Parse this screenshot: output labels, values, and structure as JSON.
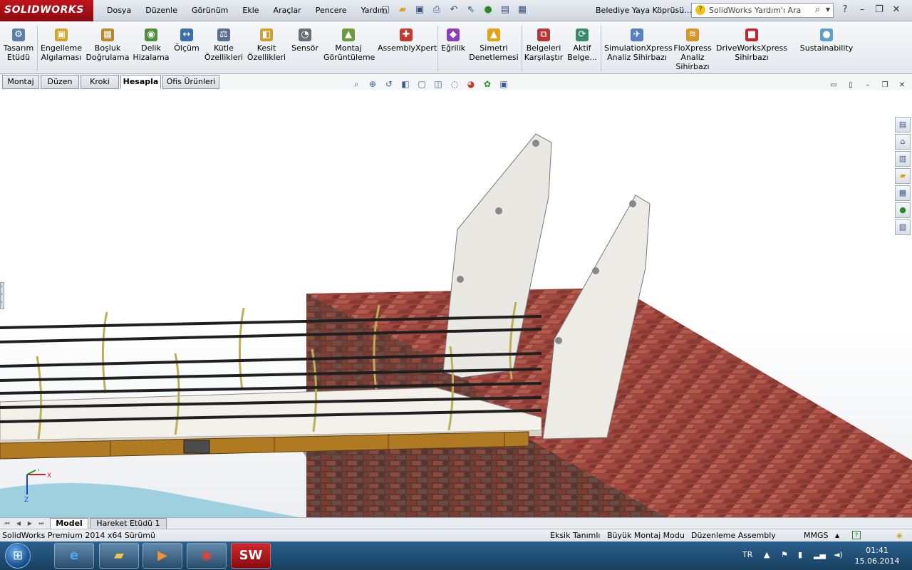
{
  "app": {
    "logo": "SOLIDWORKS",
    "doc_title": "Belediye Yaya Köprüsü...."
  },
  "menu": [
    "Dosya",
    "Düzenle",
    "Görünüm",
    "Ekle",
    "Araçlar",
    "Pencere",
    "Yardım"
  ],
  "quick_access": {
    "pin": "pin-icon",
    "new": "new-document-icon",
    "open": "open-folder-icon",
    "save": "save-icon",
    "print": "print-icon",
    "undo": "undo-icon",
    "select": "select-arrow-icon",
    "rebuild": "rebuild-traffic-light-icon",
    "file_props": "file-properties-icon",
    "options": "options-icon"
  },
  "search": {
    "placeholder": "SolidWorks Yardım'ı Ara"
  },
  "ribbon": [
    {
      "l1": "Tasarım",
      "l2": "Etüdü",
      "icon": "design-study-icon",
      "color": "#5b7fa6"
    },
    {
      "l1": "Engelleme",
      "l2": "Algılaması",
      "icon": "interference-detection-icon",
      "color": "#d0a52a"
    },
    {
      "l1": "Boşluk",
      "l2": "Doğrulama",
      "icon": "clearance-verification-icon",
      "color": "#b8892a"
    },
    {
      "l1": "Delik",
      "l2": "Hizalama",
      "icon": "hole-alignment-icon",
      "color": "#4d8f3a"
    },
    {
      "l1": "Ölçüm",
      "l2": "",
      "icon": "measure-icon",
      "color": "#3f6ea8"
    },
    {
      "l1": "Kütle",
      "l2": "Özellikleri",
      "icon": "mass-properties-icon",
      "color": "#5a6f8c"
    },
    {
      "l1": "Kesit",
      "l2": "Özellikleri",
      "icon": "section-properties-icon",
      "color": "#c9a330"
    },
    {
      "l1": "Sensör",
      "l2": "",
      "icon": "sensor-icon",
      "color": "#6b6f77"
    },
    {
      "l1": "Montaj",
      "l2": "Görüntüleme",
      "icon": "assembly-visualization-icon",
      "color": "#6c9a3c"
    },
    {
      "l1": "AssemblyXpert",
      "l2": "",
      "icon": "assemblyxpert-icon",
      "color": "#c23a2e"
    },
    {
      "l1": "Eğrilik",
      "l2": "",
      "icon": "curvature-icon",
      "color": "#8a3fb8"
    },
    {
      "l1": "Simetri",
      "l2": "Denetlemesi",
      "icon": "symmetry-check-icon",
      "color": "#e0a418"
    },
    {
      "l1": "Belgeleri",
      "l2": "Karşılaştır",
      "icon": "compare-documents-icon",
      "color": "#b43636"
    },
    {
      "l1": "Aktif",
      "l2": "Belge...",
      "icon": "active-document-icon",
      "color": "#3b8a6e"
    },
    {
      "l1": "SimulationXpress",
      "l2": "Analiz Sihirbazı",
      "icon": "simulationxpress-icon",
      "color": "#5a7fbf"
    },
    {
      "l1": "FloXpress",
      "l2": "Analiz",
      "l3": "Sihirbazı",
      "icon": "floxpress-icon",
      "color": "#d6972a"
    },
    {
      "l1": "DriveWorksXpress",
      "l2": "Sihirbazı",
      "icon": "driveworksxpress-icon",
      "color": "#c0262d"
    },
    {
      "l1": "Sustainability",
      "l2": "",
      "icon": "sustainability-icon",
      "color": "#5aa0c8"
    }
  ],
  "tabs": [
    "Montaj",
    "Düzen",
    "Kroki",
    "Hesapla",
    "Ofis Ürünleri"
  ],
  "active_tab": "Hesapla",
  "heads_up": [
    "zoom-to-fit-icon",
    "zoom-to-area-icon",
    "previous-view-icon",
    "section-view-icon",
    "view-orientation-icon",
    "display-style-icon",
    "hide-show-icon",
    "edit-appearance-icon",
    "apply-scene-icon",
    "view-settings-icon"
  ],
  "task_pane": [
    "solidworks-resources-icon",
    "home-icon",
    "design-library-icon",
    "file-explorer-icon",
    "view-palette-icon",
    "appearances-icon",
    "custom-properties-icon"
  ],
  "triad": {
    "x": "X",
    "y": "Y",
    "z": "Z"
  },
  "bottom_tabs": [
    "Model",
    "Hareket Etüdü 1"
  ],
  "status": {
    "version": "SolidWorks Premium 2014 x64 Sürümü",
    "definition": "Eksik Tanımlı",
    "mode": "Büyük Montaj Modu",
    "editing": "Düzenleme Assembly",
    "units": "MMGS",
    "units_arrow": "▲",
    "help": "?"
  },
  "taskbar": {
    "apps": [
      "windows-explorer-icon",
      "internet-explorer-icon",
      "file-manager-icon",
      "media-player-icon",
      "chrome-icon",
      "solidworks-icon"
    ],
    "lang": "TR",
    "time": "01:41",
    "date": "15.06.2014"
  },
  "colors": {
    "brick": "#8e3a33",
    "pylon": "#e9e8e3",
    "beam": "#b07a22",
    "rail": "#1f1f1f",
    "water": "#9fd0e0"
  }
}
